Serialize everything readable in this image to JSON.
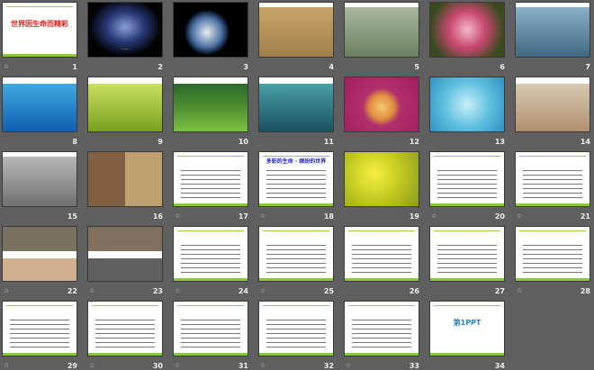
{
  "view": "slide-sorter",
  "slides": [
    {
      "num": "1",
      "kind": "text",
      "bg": "#ffffff",
      "title": "世界因生命而精彩",
      "title_color": "#e0201c",
      "anim": true
    },
    {
      "num": "2",
      "kind": "photo",
      "bg": "radial-gradient(ellipse at 50% 45%,#8aa0d8,#2a3a7a 35%,#000 70%)",
      "caption": "······",
      "anim": false
    },
    {
      "num": "3",
      "kind": "photo",
      "bg": "radial-gradient(circle at 45% 55%,#e8eef4,#4a6ea0 30%,#0a1a30 42%,#000 45%)",
      "caption": "",
      "anim": false
    },
    {
      "num": "4",
      "kind": "photo",
      "bg": "linear-gradient(#fff 0 8%,#c8a468 8%,#a0804a)",
      "caption": "",
      "anim": false
    },
    {
      "num": "5",
      "kind": "photo",
      "bg": "linear-gradient(#fff 0 8%,#a8b8a0 8%,#6c8060)",
      "caption": "",
      "anim": false
    },
    {
      "num": "6",
      "kind": "photo",
      "bg": "radial-gradient(circle at 50% 50%,#f4b8c8,#c84870 40%,#3a4a20 80%)",
      "caption": "",
      "anim": false
    },
    {
      "num": "7",
      "kind": "photo",
      "bg": "linear-gradient(#fff 0 8%,#8ab0c8 8%,#406880)",
      "caption": "",
      "anim": false
    },
    {
      "num": "8",
      "kind": "photo",
      "bg": "linear-gradient(#fff 0 12%,#40a8e0 12%,#1060b0)",
      "caption": "",
      "anim": false
    },
    {
      "num": "9",
      "kind": "photo",
      "bg": "linear-gradient(#fff 0 12%,#c8e060 12%,#7aa020)",
      "caption": "",
      "anim": false
    },
    {
      "num": "10",
      "kind": "photo",
      "bg": "linear-gradient(#fff 0 12%,#2a6a2a 12%,#4a8a30 50%,#7ac040)",
      "caption": "",
      "anim": false
    },
    {
      "num": "11",
      "kind": "photo",
      "bg": "linear-gradient(#fff 0 12%,#4aa0a8 12%,#1a5060)",
      "caption": "",
      "anim": false
    },
    {
      "num": "12",
      "kind": "photo",
      "bg": "radial-gradient(circle at 50% 55%,#f8c870,#e09040 25%,#b0306a 40%,#a02060)",
      "caption": "",
      "anim": false
    },
    {
      "num": "13",
      "kind": "photo",
      "bg": "radial-gradient(circle at 50% 50%,#c8f0f8,#60c0e0 50%,#3090c0)",
      "caption": "",
      "anim": false
    },
    {
      "num": "14",
      "kind": "photo",
      "bg": "linear-gradient(#fff 0 12%,#d8c8b0 12%,#b09070)",
      "caption": "",
      "anim": false
    },
    {
      "num": "15",
      "kind": "photo",
      "bg": "linear-gradient(#fff 0 8%,#b8b8b8 8%,#707070)",
      "caption": "",
      "anim": false
    },
    {
      "num": "16",
      "kind": "photo",
      "bg": "linear-gradient(90deg,#806040 50%,#c0a070 50%)",
      "caption": "",
      "anim": false
    },
    {
      "num": "17",
      "kind": "text",
      "bg": "#ffffff",
      "title": "",
      "title_color": "#e0201c",
      "anim": true
    },
    {
      "num": "18",
      "kind": "text",
      "bg": "#ffffff",
      "title": "多彩的生命 · 缤纷的世界",
      "title_color": "#2020d0",
      "anim": true
    },
    {
      "num": "19",
      "kind": "photo",
      "bg": "radial-gradient(circle at 40% 40%,#f8f040,#c0c820 50%,#8a9a20)",
      "caption": "",
      "anim": false
    },
    {
      "num": "20",
      "kind": "text",
      "bg": "#ffffff",
      "title": "",
      "title_color": "#e0201c",
      "anim": true
    },
    {
      "num": "21",
      "kind": "text",
      "bg": "#ffffff",
      "title": "",
      "title_color": "#e0201c",
      "anim": true
    },
    {
      "num": "22",
      "kind": "photo",
      "bg": "linear-gradient(#7a7060 0 45%,#fff 45% 58%,#d0b090 58%)",
      "caption": "",
      "anim": true
    },
    {
      "num": "23",
      "kind": "photo",
      "bg": "linear-gradient(#807060 0 45%,#fff 45% 58%,#606060 58%)",
      "caption": "",
      "anim": true
    },
    {
      "num": "24",
      "kind": "text",
      "bg": "#ffffff",
      "title": "",
      "title_color": "#30a0c0",
      "anim": true
    },
    {
      "num": "25",
      "kind": "text",
      "bg": "#ffffff",
      "title": "",
      "title_color": "#108040",
      "anim": true
    },
    {
      "num": "26",
      "kind": "text",
      "bg": "#ffffff",
      "title": "",
      "title_color": "#30a0c0",
      "anim": false
    },
    {
      "num": "27",
      "kind": "text",
      "bg": "#ffffff",
      "title": "",
      "title_color": "#30a0c0",
      "anim": false
    },
    {
      "num": "28",
      "kind": "text",
      "bg": "#ffffff",
      "title": "",
      "title_color": "#e0201c",
      "anim": true
    },
    {
      "num": "29",
      "kind": "text",
      "bg": "#ffffff",
      "title": "",
      "title_color": "#e0201c",
      "anim": true
    },
    {
      "num": "30",
      "kind": "text",
      "bg": "#ffffff",
      "title": "",
      "title_color": "#e0201c",
      "anim": true
    },
    {
      "num": "31",
      "kind": "text",
      "bg": "#ffffff",
      "title": "",
      "title_color": "#e0201c",
      "anim": true
    },
    {
      "num": "32",
      "kind": "text",
      "bg": "#ffffff",
      "title": "",
      "title_color": "#000000",
      "anim": true
    },
    {
      "num": "33",
      "kind": "text",
      "bg": "#ffffff",
      "title": "",
      "title_color": "#000000",
      "anim": true
    },
    {
      "num": "34",
      "kind": "text",
      "bg": "#ffffff",
      "title": "第1PPT",
      "title_color": "#2a80c8",
      "anim": false
    }
  ],
  "anim_icon": "animation-star-icon",
  "colors": {
    "background": "#5f5f5f",
    "accent_green": "#8cc63c"
  }
}
